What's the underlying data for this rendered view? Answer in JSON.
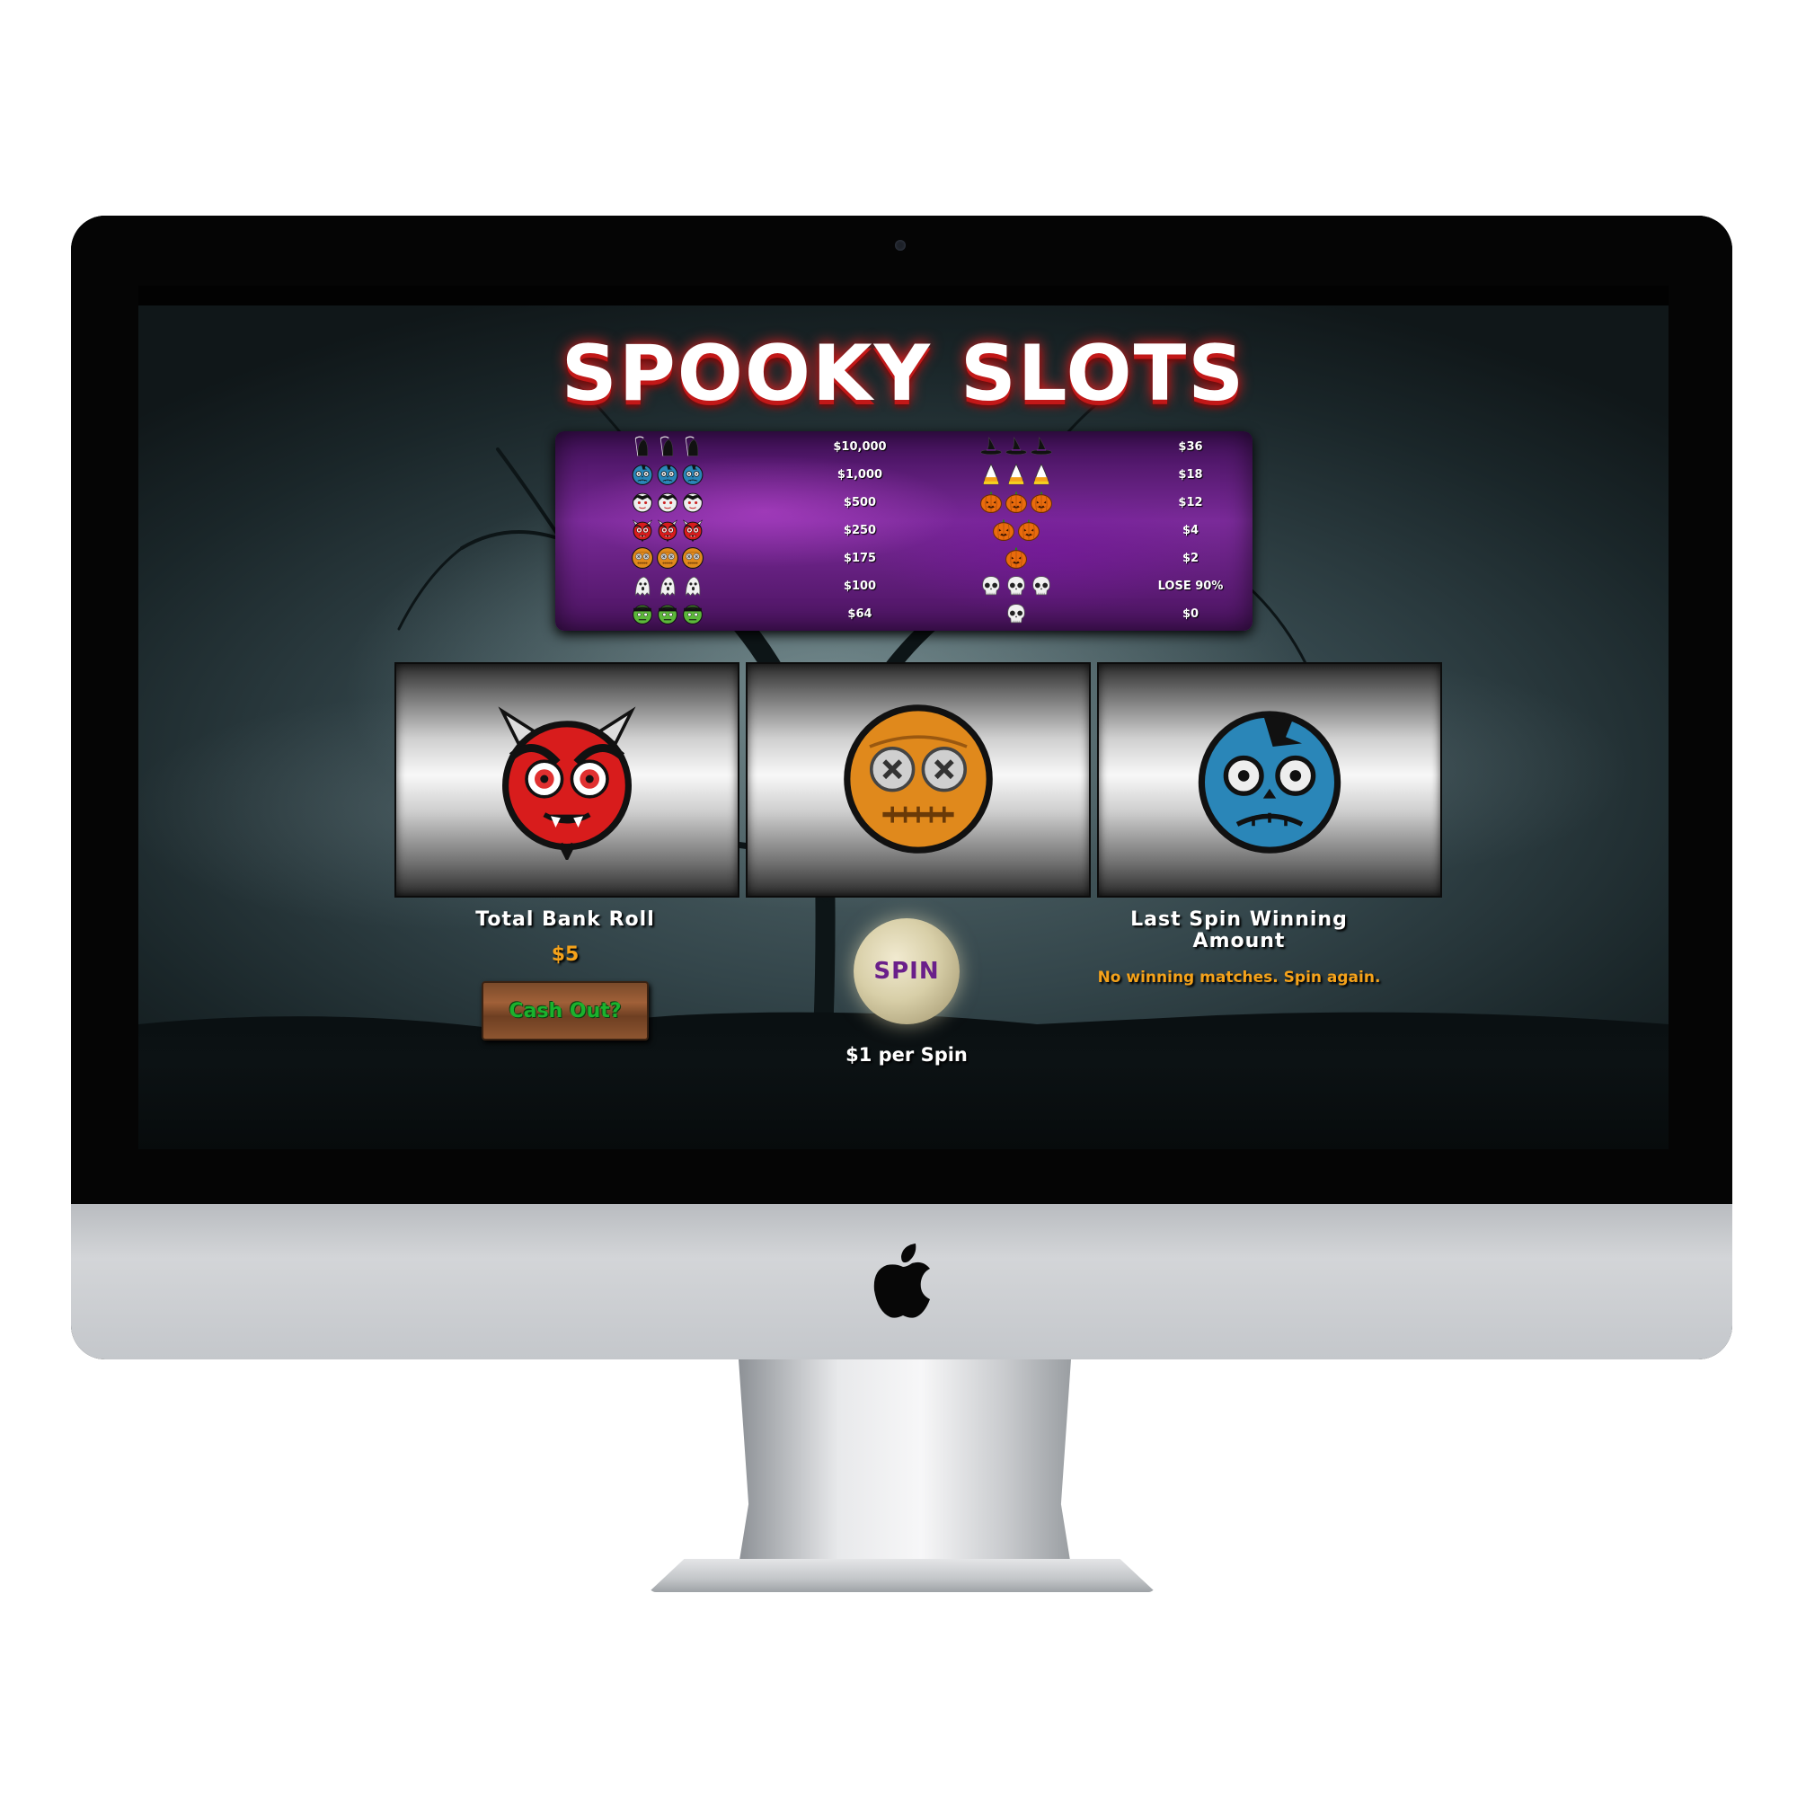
{
  "game": {
    "title": "SPOOKY SLOTS",
    "paytable": {
      "left": [
        {
          "icon": "reaper-icon",
          "payout": "$10,000"
        },
        {
          "icon": "zombie-icon",
          "payout": "$1,000"
        },
        {
          "icon": "vampire-icon",
          "payout": "$500"
        },
        {
          "icon": "devil-icon",
          "payout": "$250"
        },
        {
          "icon": "voodoo-icon",
          "payout": "$175"
        },
        {
          "icon": "ghost-icon",
          "payout": "$100"
        },
        {
          "icon": "frankenstein-icon",
          "payout": "$64"
        }
      ],
      "right": [
        {
          "icon": "witch-hat-icon",
          "count": 3,
          "payout": "$36"
        },
        {
          "icon": "candy-corn-icon",
          "count": 3,
          "payout": "$18"
        },
        {
          "icon": "pumpkin-icon",
          "count": 3,
          "payout": "$12"
        },
        {
          "icon": "pumpkin-icon",
          "count": 2,
          "payout": "$4"
        },
        {
          "icon": "pumpkin-icon",
          "count": 1,
          "payout": "$2"
        },
        {
          "icon": "skull-icon",
          "count": 3,
          "payout": "LOSE 90%"
        },
        {
          "icon": "skull-icon",
          "count": 1,
          "payout": "$0"
        }
      ]
    },
    "reels": [
      "devil-icon",
      "voodoo-icon",
      "zombie-icon"
    ],
    "bank": {
      "label": "Total Bank Roll",
      "value": "$5"
    },
    "cashout_label": "Cash Out?",
    "spin": {
      "label": "SPIN",
      "cost_label": "$1 per Spin"
    },
    "last_spin": {
      "label_line1": "Last Spin Winning",
      "label_line2": "Amount",
      "message": "No winning matches. Spin again."
    },
    "colors": {
      "title": "#ffffff",
      "title_drip": "#c21818",
      "accent": "#f5a21a",
      "paytable": "#7a2a99",
      "cashout_text": "#1bb22d",
      "spin_text": "#6a1f8a"
    }
  }
}
